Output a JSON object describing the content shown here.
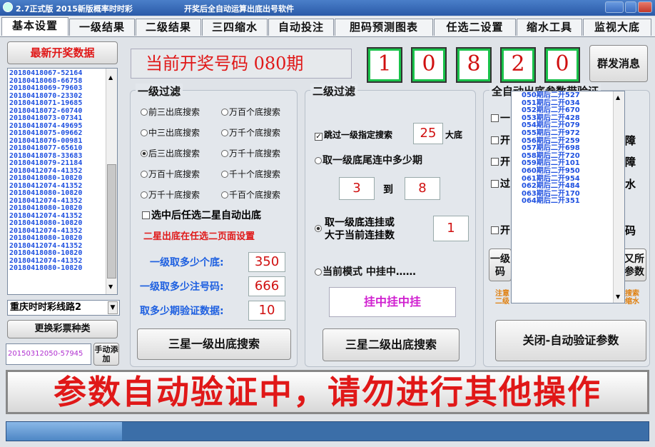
{
  "window": {
    "version_label": "2.7正式版 2015新版概率时时彩",
    "subtitle": "开奖后全自动运算出底出号软件"
  },
  "tabs": [
    "基本设置",
    "一级结果",
    "二级结果",
    "三四缩水",
    "自动投注",
    "胆码预测图表",
    "任选二设置",
    "缩水工具",
    "监视大底"
  ],
  "left": {
    "header": "最新开奖数据",
    "draws": [
      "20180418067-52164",
      "20180418068-66758",
      "20180418069-79603",
      "20180418070-23302",
      "20180418071-19685",
      "20180418072-60740",
      "20180418073-07341",
      "20180418074-49695",
      "20180418075-09662",
      "20180418076-00981",
      "20180418077-65610",
      "20180418078-33683",
      "20180418079-21184",
      "20180412074-41352",
      "20180418080-10820",
      "20180412074-41352",
      "20180418080-10820",
      "20180412074-41352",
      "20180418080-10820",
      "20180412074-41352",
      "20180418080-10820",
      "20180412074-41352",
      "20180418080-10820",
      "20180412074-41352",
      "20180418080-10820",
      "20180412074-41352",
      "20180418080-10820"
    ],
    "line_select": "重庆时时彩线路2",
    "change_type_button": "更换彩票种类",
    "manual_input": "20150312050-57945",
    "manual_add_button": "手动添加"
  },
  "current": {
    "label": "当前开奖号码 080期",
    "digits": [
      "1",
      "0",
      "8",
      "2",
      "0"
    ],
    "group_msg_button": "群发消息"
  },
  "level1": {
    "title": "一级过滤",
    "radios": [
      {
        "label": "前三出底搜索",
        "checked": false
      },
      {
        "label": "万百个底搜索",
        "checked": false
      },
      {
        "label": "中三出底搜索",
        "checked": false
      },
      {
        "label": "万千个底搜索",
        "checked": false
      },
      {
        "label": "后三出底搜索",
        "checked": true
      },
      {
        "label": "万千十底搜索",
        "checked": false
      },
      {
        "label": "万百十底搜索",
        "checked": false
      },
      {
        "label": "千十个底搜索",
        "checked": false
      },
      {
        "label": "万千十底搜索",
        "checked": false
      },
      {
        "label": "千百个底搜索",
        "checked": false
      }
    ],
    "auto_check_label": "选中后任选二星自动出底",
    "note": "二星出底在任选二页面设置",
    "fields": [
      {
        "label": "一级取多少个底:",
        "value": "350"
      },
      {
        "label": "一级取多少注号码:",
        "value": "666"
      },
      {
        "label": "取多少期验证数据:",
        "value": "10"
      }
    ],
    "search_button": "三星一级出底搜索"
  },
  "level2": {
    "title": "二级过滤",
    "skip_label": "跳过一级指定搜索",
    "skip_value": "25",
    "skip_unit": "大底",
    "tail_label": "取一级底尾连中多少期",
    "range_from": "3",
    "range_to_label": "到",
    "range_to": "8",
    "hang_label_1": "取一级底连挂或",
    "hang_label_2": "大于当前连挂数",
    "hang_value": "1",
    "mode_label": "当前模式  中挂中……",
    "mode_button": "挂中挂中挂",
    "search_button": "三星二级出底搜索"
  },
  "verify": {
    "title": "全自动出底参数带验证",
    "row_labels": [
      "一",
      "开",
      "开",
      "过",
      "开"
    ],
    "right_glyphs": [
      "障",
      "障",
      "水",
      "码"
    ],
    "btn_left": "一级码",
    "btn_right": "又所参数",
    "note_left": "注意二级",
    "note_right": "搜索缩水",
    "close_button": "关闭-自动验证参数",
    "periods": [
      "050期后二开527",
      "051期后二开034",
      "052期后二开670",
      "053期后二开428",
      "054期后二开079",
      "055期后二开972",
      "056期后二开259",
      "057期后二开698",
      "058期后二开720",
      "059期后二开101",
      "060期后二开950",
      "061期后二开954",
      "062期后二开484",
      "063期后二开170",
      "064期后二开351"
    ]
  },
  "banner": "参数自动验证中，请勿进行其他操作",
  "progress": {
    "percent": 18
  }
}
